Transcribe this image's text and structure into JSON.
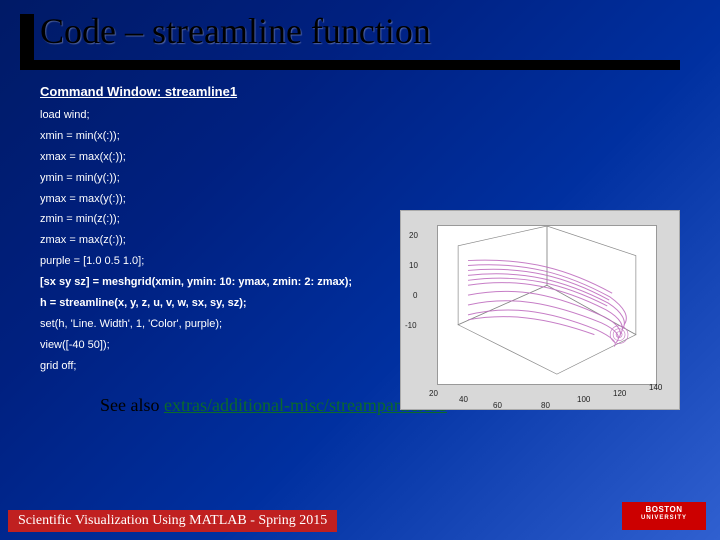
{
  "title": "Code – streamline function",
  "section_heading": "Command Window: streamline1",
  "code_lines": [
    {
      "text": "load wind;",
      "bold": false
    },
    {
      "text": "xmin = min(x(:));",
      "bold": false
    },
    {
      "text": "xmax = max(x(:));",
      "bold": false
    },
    {
      "text": "ymin = min(y(:));",
      "bold": false
    },
    {
      "text": "ymax = max(y(:));",
      "bold": false
    },
    {
      "text": "zmin = min(z(:));",
      "bold": false
    },
    {
      "text": "zmax = max(z(:));",
      "bold": false
    },
    {
      "text": "purple = [1.0 0.5 1.0];",
      "bold": false
    },
    {
      "text": "[sx sy sz] = meshgrid(xmin, ymin: 10: ymax, zmin: 2: zmax);",
      "bold": true
    },
    {
      "text": "h = streamline(x, y, z, u, v, w, sx, sy, sz);",
      "bold": true
    },
    {
      "text": "set(h, 'Line. Width', 1, 'Color', purple);",
      "bold": false
    },
    {
      "text": "view([-40 50]);",
      "bold": false
    },
    {
      "text": "grid off;",
      "bold": false
    }
  ],
  "see_also_prefix": "See also ",
  "see_also_link": "extras/additional-misc/streamparticles1",
  "footer": "Scientific Visualization Using MATLAB - Spring 2015",
  "logo": {
    "line1": "BOSTON",
    "line2": "UNIVERSITY"
  },
  "chart_data": {
    "type": "line",
    "title": "",
    "description": "MATLAB 3D streamline plot of wind vector field",
    "axes": {
      "x": {
        "range": [
          80,
          140
        ],
        "ticks": [
          80,
          100,
          120,
          140
        ]
      },
      "y": {
        "range": [
          20,
          60
        ],
        "ticks": [
          20,
          40,
          60
        ]
      },
      "z": {
        "range": [
          -10,
          20
        ],
        "ticks": [
          -10,
          0,
          10,
          20
        ]
      }
    },
    "view": [
      -40,
      50
    ],
    "streamlines_color": "#d080d0",
    "streamlines_count_approx": 20
  },
  "plot_ticks": {
    "left": [
      "20",
      "10",
      "0",
      "-10"
    ],
    "bottom_left": [
      "20",
      "40",
      "60"
    ],
    "bottom_right": [
      "80",
      "100",
      "120",
      "140"
    ]
  }
}
